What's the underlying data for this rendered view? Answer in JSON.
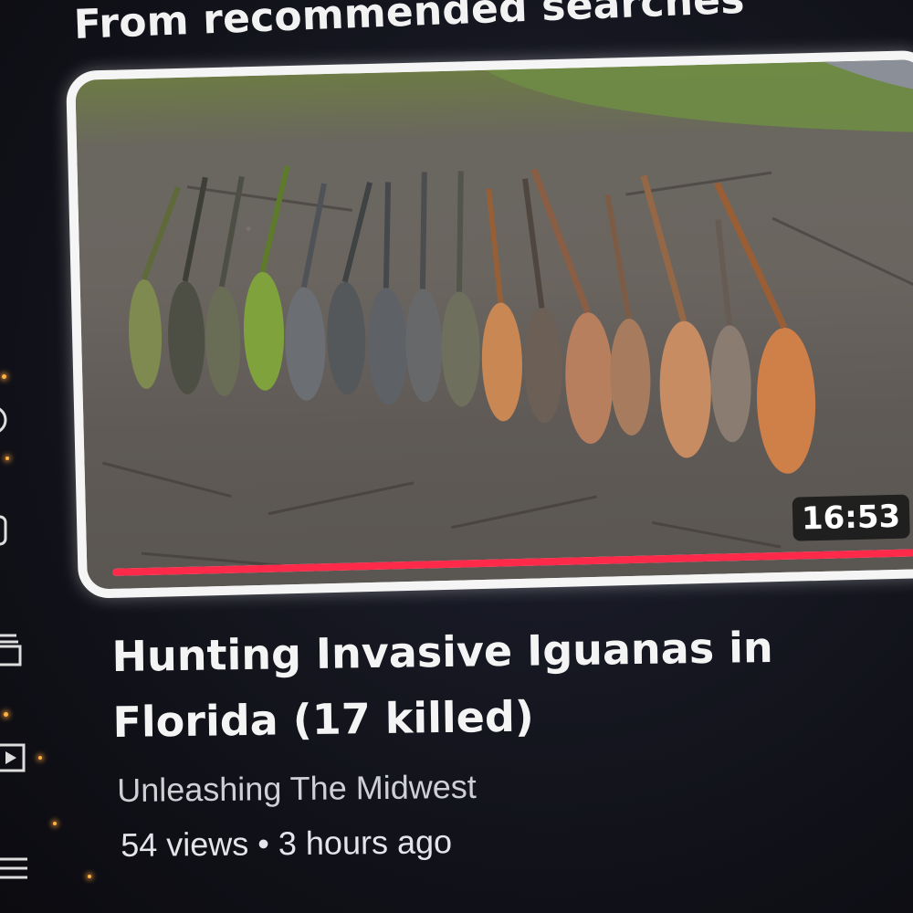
{
  "section": {
    "title": "From recommended searches"
  },
  "video": {
    "title": "Hunting Invasive Iguanas in Florida (17 killed)",
    "channel": "Unleashing The Midwest",
    "meta": "54 views • 3 hours ago",
    "duration": "16:53",
    "watched_fraction": 1.0,
    "thumbnail_alt": "iguanas-on-ground"
  },
  "rail": {
    "icons": [
      "history-icon",
      "shorts-icon",
      "subscriptions-icon",
      "library-icon",
      "menu-icon"
    ]
  },
  "colors": {
    "progress": "#ff2a4a",
    "background": "#13141c",
    "card_border": "#f5f5f5"
  }
}
